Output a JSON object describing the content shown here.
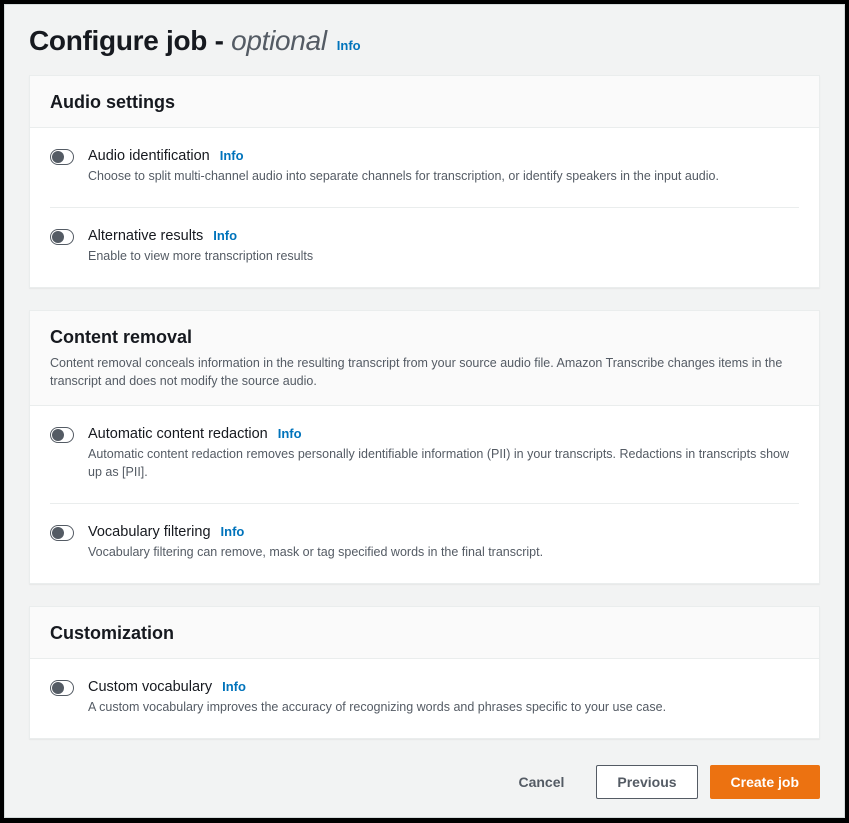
{
  "header": {
    "title_main": "Configure job ",
    "title_dash": "- ",
    "title_em": "optional",
    "info": "Info"
  },
  "info_label": "Info",
  "panels": {
    "audio": {
      "title": "Audio settings",
      "items": {
        "identification": {
          "name": "Audio identification",
          "desc": "Choose to split multi-channel audio into separate channels for transcription, or identify speakers in the input audio."
        },
        "alternative": {
          "name": "Alternative results",
          "desc": "Enable to view more transcription results"
        }
      }
    },
    "removal": {
      "title": "Content removal",
      "desc": "Content removal conceals information in the resulting transcript from your source audio file. Amazon Transcribe changes items in the transcript and does not modify the source audio.",
      "items": {
        "redaction": {
          "name": "Automatic content redaction",
          "desc": "Automatic content redaction removes personally identifiable information (PII) in your transcripts. Redactions in transcripts show up as [PII]."
        },
        "vocabfilter": {
          "name": "Vocabulary filtering",
          "desc": "Vocabulary filtering can remove, mask or tag specified words in the final transcript."
        }
      }
    },
    "custom": {
      "title": "Customization",
      "items": {
        "customvocab": {
          "name": "Custom vocabulary",
          "desc": "A custom vocabulary improves the accuracy of recognizing words and phrases specific to your use case."
        }
      }
    }
  },
  "footer": {
    "cancel": "Cancel",
    "previous": "Previous",
    "create": "Create job"
  }
}
